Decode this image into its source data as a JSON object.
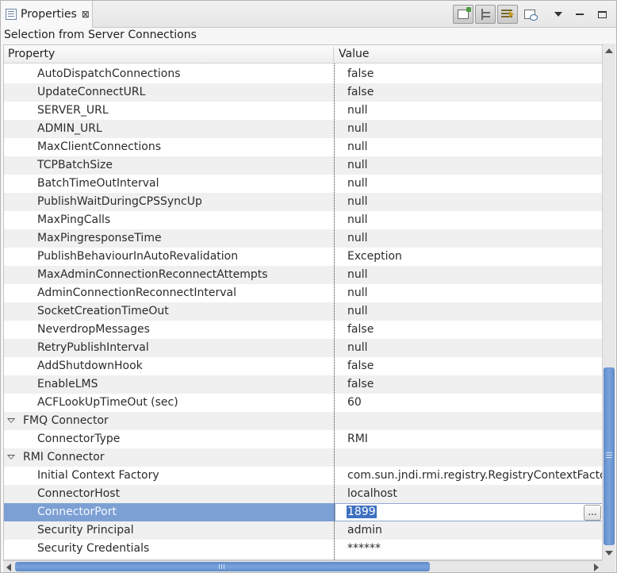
{
  "tab": {
    "title": "Properties",
    "icon": "properties-icon",
    "close_glyph": "⊠"
  },
  "toolbar": {
    "buttons": [
      {
        "name": "pin-to-selection-button",
        "icon": "pin-icon"
      },
      {
        "name": "show-categories-button",
        "icon": "tree-icon"
      },
      {
        "name": "show-advanced-button",
        "icon": "advanced-properties-icon"
      },
      {
        "name": "restore-default-button",
        "icon": "restore-default-icon"
      }
    ],
    "view_menu_icon": "view-menu-icon",
    "minimize_icon": "minimize-icon",
    "maximize_icon": "maximize-icon"
  },
  "selection_title": "Selection from Server Connections",
  "columns": {
    "property": "Property",
    "value": "Value"
  },
  "rows": [
    {
      "property": "AutoDispatchConnections",
      "value": "false"
    },
    {
      "property": "UpdateConnectURL",
      "value": "false"
    },
    {
      "property": "SERVER_URL",
      "value": "null"
    },
    {
      "property": "ADMIN_URL",
      "value": "null"
    },
    {
      "property": "MaxClientConnections",
      "value": "null"
    },
    {
      "property": "TCPBatchSize",
      "value": "null"
    },
    {
      "property": "BatchTimeOutInterval",
      "value": "null"
    },
    {
      "property": "PublishWaitDuringCPSSyncUp",
      "value": "null"
    },
    {
      "property": "MaxPingCalls",
      "value": "null"
    },
    {
      "property": "MaxPingresponseTime",
      "value": "null"
    },
    {
      "property": "PublishBehaviourInAutoRevalidation",
      "value": "Exception"
    },
    {
      "property": "MaxAdminConnectionReconnectAttempts",
      "value": "null"
    },
    {
      "property": "AdminConnectionReconnectInterval",
      "value": "null"
    },
    {
      "property": "SocketCreationTimeOut",
      "value": "null"
    },
    {
      "property": "NeverdropMessages",
      "value": "false"
    },
    {
      "property": "RetryPublishInterval",
      "value": "null"
    },
    {
      "property": "AddShutdownHook",
      "value": "false"
    },
    {
      "property": "EnableLMS",
      "value": "false"
    },
    {
      "property": "ACFLookUpTimeOut (sec)",
      "value": "60"
    },
    {
      "property": "FMQ Connector",
      "value": "",
      "category": true
    },
    {
      "property": "ConnectorType",
      "value": "RMI"
    },
    {
      "property": "RMI Connector",
      "value": "",
      "category": true
    },
    {
      "property": "Initial Context Factory",
      "value": "com.sun.jndi.rmi.registry.RegistryContextFactory"
    },
    {
      "property": "ConnectorHost",
      "value": "localhost"
    },
    {
      "property": "ConnectorPort",
      "value": "1899",
      "selected": true,
      "editing": true,
      "edit_button": "..."
    },
    {
      "property": "Security Principal",
      "value": "admin"
    },
    {
      "property": "Security Credentials",
      "value": "******"
    }
  ],
  "scroll": {
    "vertical_position": 0.63,
    "horizontal_position": 0.0
  }
}
